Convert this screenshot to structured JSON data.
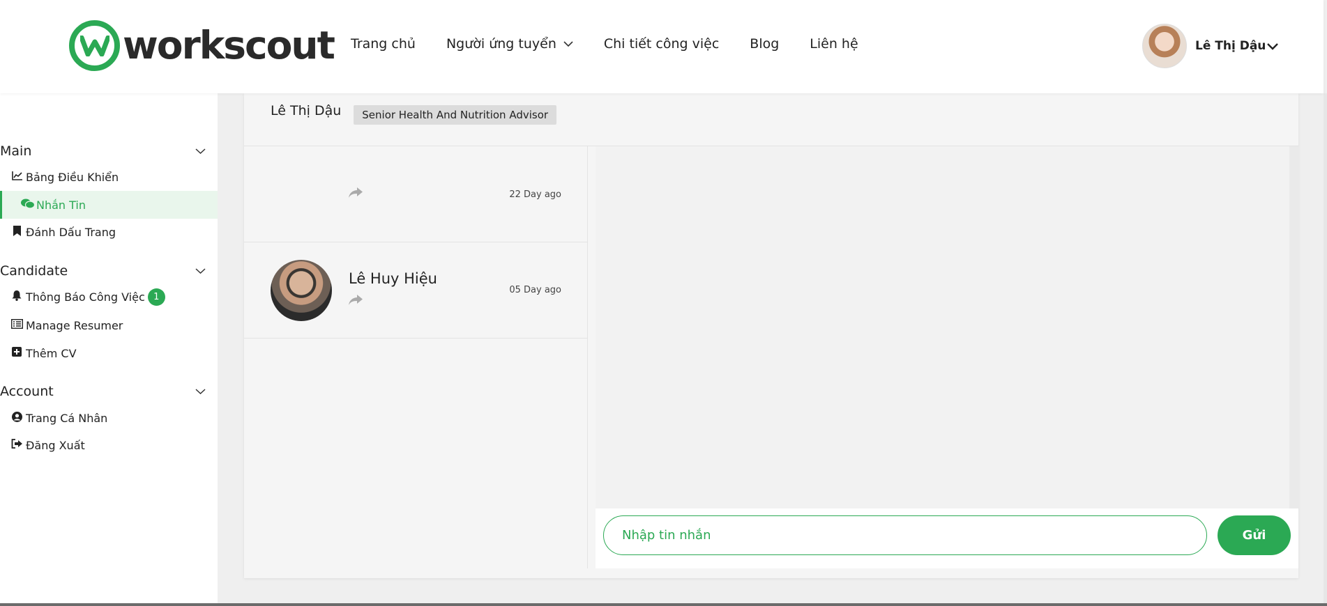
{
  "header": {
    "logo_text": "workscout",
    "nav": [
      {
        "label": "Trang chủ",
        "has_dropdown": false
      },
      {
        "label": "Người ứng tuyển",
        "has_dropdown": true
      },
      {
        "label": "Chi tiết công việc",
        "has_dropdown": false
      },
      {
        "label": "Blog",
        "has_dropdown": false
      },
      {
        "label": "Liên hệ",
        "has_dropdown": false
      }
    ],
    "user_name": "Lê Thị Dậu"
  },
  "sidebar": {
    "groups": [
      {
        "title": "Main",
        "items": [
          {
            "label": "Bảng Điều Khiển",
            "icon": "chart-line-icon"
          },
          {
            "label": "Nhắn Tin",
            "icon": "comments-icon",
            "active": true
          },
          {
            "label": "Đánh Dấu Trang",
            "icon": "bookmark-icon"
          }
        ]
      },
      {
        "title": "Candidate",
        "items": [
          {
            "label": "Thông Báo Công Việc",
            "icon": "bell-icon",
            "badge": "1"
          },
          {
            "label": "Manage Resumer",
            "icon": "list-icon"
          },
          {
            "label": "Thêm CV",
            "icon": "plus-square-icon"
          }
        ]
      },
      {
        "title": "Account",
        "items": [
          {
            "label": "Trang Cá Nhân",
            "icon": "user-circle-icon"
          },
          {
            "label": "Đăng Xuất",
            "icon": "sign-out-icon"
          }
        ]
      }
    ]
  },
  "chat": {
    "header_name": "Lê Thị Dậu",
    "header_tag": "Senior Health And Nutrition Advisor",
    "conversations": [
      {
        "name": "",
        "time": "22 Day ago",
        "has_avatar": false
      },
      {
        "name": "Lê Huy Hiệu",
        "time": "05 Day ago",
        "has_avatar": true
      }
    ],
    "input_placeholder": "Nhập tin nhắn",
    "send_label": "Gửi"
  },
  "colors": {
    "accent": "#2ba954",
    "active_bg": "#e9f6ec"
  }
}
